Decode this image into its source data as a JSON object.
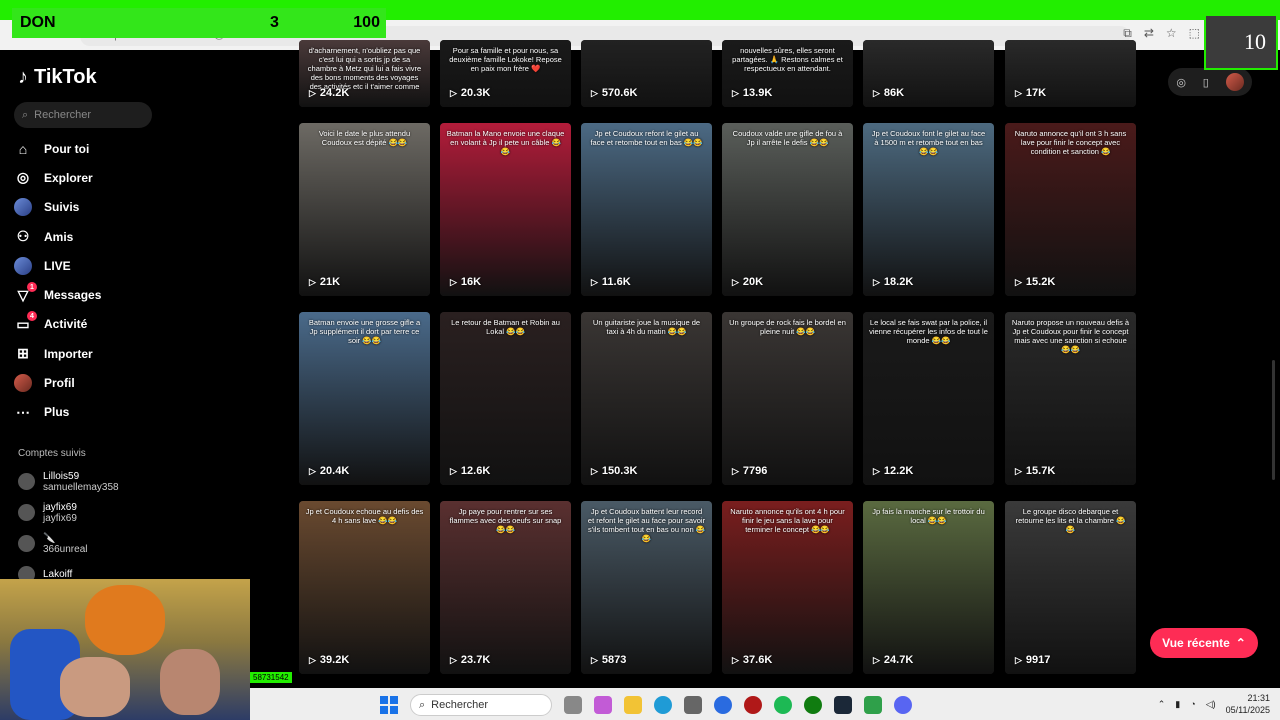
{
  "overlay": {
    "label": "DON",
    "count": "3",
    "goal": "100",
    "counter": "10",
    "cam_tag": "58731542"
  },
  "browser": {
    "url": "https://www.tiktok.com/@..."
  },
  "app": {
    "name": "TikTok"
  },
  "search": {
    "placeholder": "Rechercher"
  },
  "nav": [
    {
      "label": "Pour toi",
      "icon": "home-icon"
    },
    {
      "label": "Explorer",
      "icon": "compass-icon"
    },
    {
      "label": "Suivis",
      "icon": "following-avatar-icon"
    },
    {
      "label": "Amis",
      "icon": "friends-icon"
    },
    {
      "label": "LIVE",
      "icon": "live-icon"
    },
    {
      "label": "Messages",
      "icon": "messages-icon",
      "badge": "1"
    },
    {
      "label": "Activité",
      "icon": "activity-icon",
      "badge": "4"
    },
    {
      "label": "Importer",
      "icon": "upload-icon"
    },
    {
      "label": "Profil",
      "icon": "profile-avatar-icon"
    },
    {
      "label": "Plus",
      "icon": "more-icon"
    }
  ],
  "following": {
    "heading": "Comptes suivis",
    "accounts": [
      {
        "name": "Lillois59",
        "handle": "samuellemay358"
      },
      {
        "name": "jayfix69",
        "handle": "jayfix69"
      },
      {
        "name": "🔪",
        "handle": "366unreal"
      },
      {
        "name": "Lakoiff",
        "handle": ""
      }
    ]
  },
  "videos": [
    {
      "caption": "d'acharnement, n'oubliez pas que c'est lui qui a sortis jp de sa chambre à Metz qui lui a fais vivre des bons moments des voyages des activités etc il t'aimer comme",
      "views": "24.2K",
      "color": "#4a3a3a"
    },
    {
      "caption": "Pour sa famille et pour nous, sa deuxième famille Lokoke! Repose en paix mon frère ❤️",
      "views": "20.3K",
      "color": "#1a1a1a"
    },
    {
      "caption": "",
      "views": "570.6K",
      "color": "#222"
    },
    {
      "caption": "nouvelles sûres, elles seront partagées. 🙏 Restons calmes et respectueux en attendant.",
      "views": "13.9K",
      "color": "#1a1a1a"
    },
    {
      "caption": "",
      "views": "86K",
      "color": "#2a2a2a"
    },
    {
      "caption": "",
      "views": "17K",
      "color": "#2a2a2a"
    },
    {
      "caption": "Voici le date le plus attendu Coudoux est dépité 😂😂",
      "views": "21K",
      "color": "#6d6a64"
    },
    {
      "caption": "Batman la Mano envoie une claque en volant à Jp il pete un câble 😂😂",
      "views": "16K",
      "color": "#b31c3a"
    },
    {
      "caption": "Jp et Coudoux refont le gilet au face et retombe tout en bas 😂😂",
      "views": "11.6K",
      "color": "#4c6a84"
    },
    {
      "caption": "Coudoux valde une gifle de fou à Jp il arrête le defis 😂😂",
      "views": "20K",
      "color": "#5a5e5a"
    },
    {
      "caption": "Jp et Coudoux font le gilet au face à 1500 m et retombe tout en bas 😂😂",
      "views": "18.2K",
      "color": "#4d6a80"
    },
    {
      "caption": "Naruto annonce qu'il ont 3 h sans lave pour finir le concept avec condition et sanction 😂",
      "views": "15.2K",
      "color": "#4a1a1a"
    },
    {
      "caption": "Batman envoie une grosse gifle a Jp supplément il dort par terre ce soir 😂😂",
      "views": "20.4K",
      "color": "#4a6a8a"
    },
    {
      "caption": "Le retour de Batman et Robin au Lokal 😂😂",
      "views": "12.6K",
      "color": "#2a2020"
    },
    {
      "caption": "Un guitariste joue la musique de taxi à 4h du matin 😂😂",
      "views": "150.3K",
      "color": "#3a3634"
    },
    {
      "caption": "Un groupe de rock fais le bordel en pleine nuit 😂😂",
      "views": "7796",
      "color": "#3a3634"
    },
    {
      "caption": "Le local se fais swat par la police, il vienne récupérer les infos de tout le monde 😂😂",
      "views": "12.2K",
      "color": "#1a1a1a"
    },
    {
      "caption": "Naruto propose un nouveau defis à Jp et Coudoux pour finir le concept mais avec une sanction si echoue 😂😂",
      "views": "15.7K",
      "color": "#2a2a2a"
    },
    {
      "caption": "Jp et Coudoux echoue au defis des 4 h sans lave 😂😂",
      "views": "39.2K",
      "color": "#6a4a30"
    },
    {
      "caption": "Jp paye pour rentrer sur ses flammes avec des oeufs sur snap 😂😂",
      "views": "23.7K",
      "color": "#5a3030"
    },
    {
      "caption": "Jp et Coudoux battent leur record et refont le gilet au face pour savoir s'ils tombent tout en bas ou non 😂😂",
      "views": "5873",
      "color": "#4a5a66"
    },
    {
      "caption": "Naruto annonce qu'ils ont 4 h pour finir le jeu sans la lave pour terminer le concept 😂😂",
      "views": "37.6K",
      "color": "#7a1e1e"
    },
    {
      "caption": "Jp fais la manche sur le trottoir du local 😂😂",
      "views": "24.7K",
      "color": "#5a6a40"
    },
    {
      "caption": "Le groupe disco debarque et retourne les lits et la chambre 😂😂",
      "views": "9917",
      "color": "#3a3a3a"
    }
  ],
  "recent_button": {
    "label": "Vue récente"
  },
  "taskbar": {
    "search_label": "Rechercher",
    "time": "21:31",
    "date": "05/11/2025"
  }
}
